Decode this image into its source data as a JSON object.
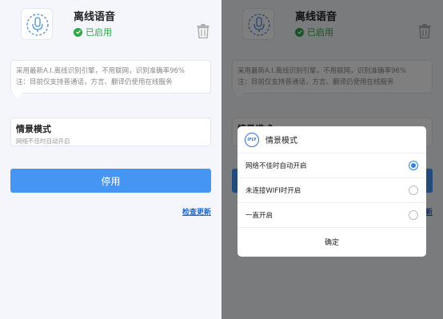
{
  "app": {
    "title": "离线语音",
    "status": "已启用",
    "description_line1": "采用最新A.I.离线识别引擎，不用联网，识别准确率96%",
    "description_line2": "注：目前仅支持普通话，方言、翻译仍使用在线服务"
  },
  "scene_mode": {
    "title": "情景模式",
    "value": "网络不佳时自动开启"
  },
  "buttons": {
    "disable": "停用",
    "check_update": "检查更新"
  },
  "dialog": {
    "logo_text": "iFLY",
    "title": "情景模式",
    "options": [
      {
        "label": "网络不佳时自动开启",
        "selected": true
      },
      {
        "label": "未连接WIFI时开启",
        "selected": false
      },
      {
        "label": "一直开启",
        "selected": false
      }
    ],
    "confirm": "确定"
  },
  "colors": {
    "accent": "#4596f3",
    "status_green": "#2aa845",
    "radio_selected": "#2a85e4"
  },
  "icons": {
    "app": "microphone-icon",
    "status": "check-circle-icon",
    "delete": "trash-icon"
  }
}
